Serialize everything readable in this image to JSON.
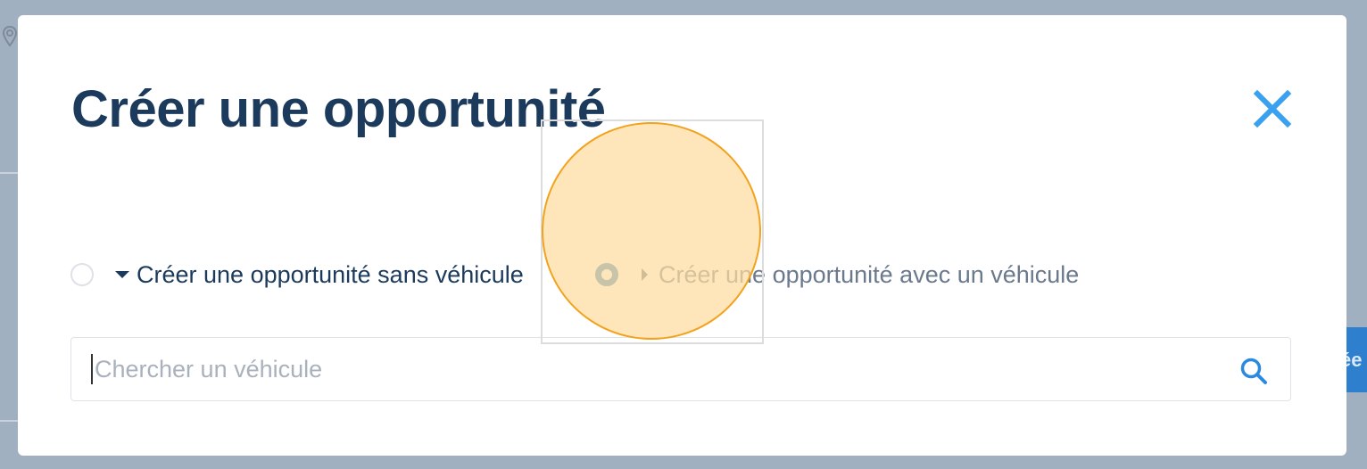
{
  "colors": {
    "backdrop": "#a1b0c0",
    "title": "#1b3a5c",
    "accent": "#3a86c5",
    "close_icon": "#3aa0f0",
    "search_icon": "#2a8ae0",
    "click_highlight": "#f2a21c"
  },
  "background": {
    "partial_button_label": "ée",
    "pin_icon": "map-pin-icon"
  },
  "modal": {
    "title": "Créer une opportunité",
    "close_icon": "close-icon",
    "options": [
      {
        "label": "Créer une opportunité sans véhicule",
        "selected": false,
        "caret": "caret-down"
      },
      {
        "label": "Créer une opportunité avec un véhicule",
        "selected": true,
        "caret": "caret-right"
      }
    ],
    "search": {
      "placeholder": "Chercher un véhicule",
      "value": "",
      "icon": "search-icon"
    }
  }
}
